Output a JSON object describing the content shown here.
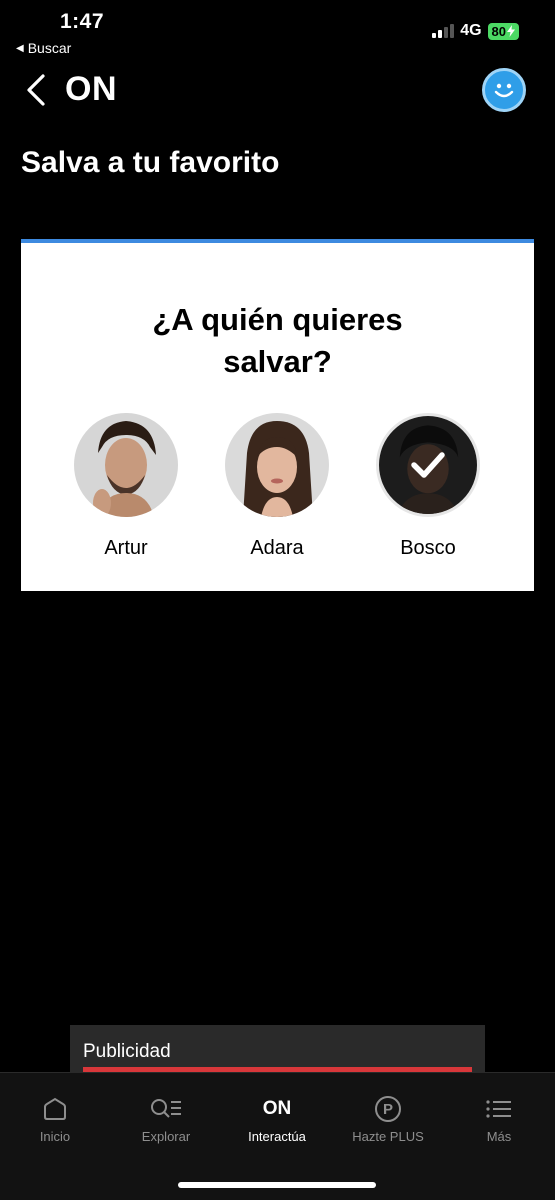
{
  "status": {
    "time": "1:47",
    "back_app": "Buscar",
    "network": "4G",
    "battery": "80"
  },
  "header": {
    "title": "ON"
  },
  "page_title": "Salva a tu favorito",
  "card": {
    "question": "¿A quién quieres salvar?",
    "candidates": [
      {
        "name": "Artur",
        "selected": false
      },
      {
        "name": "Adara",
        "selected": false
      },
      {
        "name": "Bosco",
        "selected": true
      }
    ],
    "accent": "#3d8ae0"
  },
  "ad": {
    "label": "Publicidad"
  },
  "nav": {
    "items": [
      {
        "label": "Inicio",
        "icon": "home-icon"
      },
      {
        "label": "Explorar",
        "icon": "explore-icon"
      },
      {
        "label": "Interactúa",
        "icon": "on-icon",
        "icon_text": "ON",
        "active": true
      },
      {
        "label": "Hazte PLUS",
        "icon": "plus-icon",
        "icon_text": "P"
      },
      {
        "label": "Más",
        "icon": "menu-icon"
      }
    ]
  }
}
